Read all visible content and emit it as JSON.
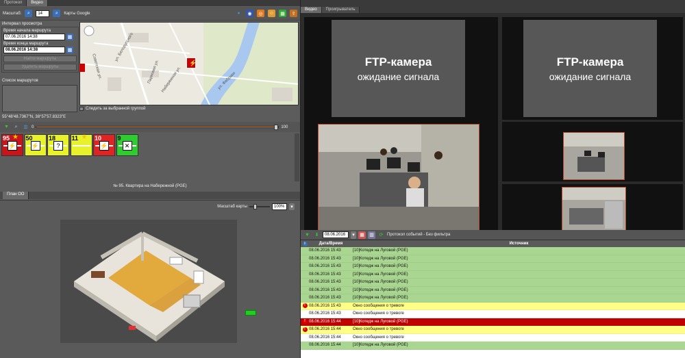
{
  "left_tabs": [
    "Протокол",
    "Видео"
  ],
  "toolbar": {
    "scale_label": "Масштаб:",
    "scale_value": "14",
    "maps_label": "Карты Google"
  },
  "interval": {
    "title": "Интервал просмотра",
    "start_label": "Время начала маршрута",
    "start_value": "07.06.2016 14:38",
    "end_label": "Время конца маршрута",
    "end_value": "08.06.2016 14:38",
    "search_btn": "Найти маршруты",
    "delete_btn": "Удалить маршруты",
    "routes_title": "Список маршрутов"
  },
  "map": {
    "follow_label": "Следить за выбранной группой",
    "coords": "55°48'48.7367\"N, 38°57'57.8323\"E",
    "streets": [
      "Советская ул.",
      "ул. Белорусского",
      "Парковая ул.",
      "Набережная ул.",
      "ул. Фабрики"
    ]
  },
  "slider": {
    "min": "0",
    "max": "100",
    "value_fraction": 1.0
  },
  "tiles": [
    {
      "num": "95",
      "color": "#c8151a",
      "icon": "run-icon",
      "glyph": "⚡",
      "star": true
    },
    {
      "num": "50",
      "color": "#e8f22a",
      "icon": "run-icon",
      "glyph": "⚡",
      "star": false
    },
    {
      "num": "18",
      "color": "#e8f22a",
      "icon": "question-icon",
      "glyph": "?",
      "star": false
    },
    {
      "num": "11",
      "color": "#e8f22a",
      "icon": "star-icon",
      "glyph": "",
      "star": true
    },
    {
      "num": "10",
      "color": "#e02424",
      "icon": "run-icon",
      "glyph": "⚡",
      "star": false
    },
    {
      "num": "9",
      "color": "#2ecc2e",
      "icon": "cross-icon",
      "glyph": "✕",
      "star": false
    }
  ],
  "plan": {
    "header": "№ 95. Квартира на Набережной (PGE)",
    "tab": "План ОО",
    "scale_label": "Масштаб карты",
    "scale_value": "100%"
  },
  "right_tabs": [
    "Видео",
    "Проигрыватель"
  ],
  "cameras": {
    "off_title": "FTP-камера",
    "off_subtitle": "ожидание сигнала"
  },
  "events_toolbar": {
    "date": "08.06.2016",
    "title": "Протокол событий - Без фильтра"
  },
  "events_table": {
    "headers": [
      "Дата/Время",
      "Источник"
    ],
    "rows": [
      {
        "time": "08.06.2016 15:43",
        "source": "[10]Котедж на Луговой (PGE)",
        "bg": "#a9d691",
        "alarm": false
      },
      {
        "time": "08.06.2016 15:43",
        "source": "[10]Котедж на Луговой (PGE)",
        "bg": "#a9d691",
        "alarm": false
      },
      {
        "time": "08.06.2016 15:43",
        "source": "[10]Котедж на Луговой (PGE)",
        "bg": "#a9d691",
        "alarm": false
      },
      {
        "time": "08.06.2016 15:43",
        "source": "[10]Котедж на Луговой (PGE)",
        "bg": "#a9d691",
        "alarm": false
      },
      {
        "time": "08.06.2016 15:43",
        "source": "[10]Котедж на Луговой (PGE)",
        "bg": "#a9d691",
        "alarm": false
      },
      {
        "time": "08.06.2016 15:43",
        "source": "[10]Котедж на Луговой (PGE)",
        "bg": "#a9d691",
        "alarm": false
      },
      {
        "time": "08.06.2016 15:43",
        "source": "[10]Котедж на Луговой (PGE)",
        "bg": "#a9d691",
        "alarm": false
      },
      {
        "time": "08.06.2016 15:43",
        "source": "Окно сообщения о тревоге",
        "bg": "#ffff88",
        "alarm": true
      },
      {
        "time": "08.06.2016 15:43",
        "source": "Окно сообщения о тревоге",
        "bg": "#ffffff",
        "alarm": false
      },
      {
        "time": "08.06.2016 15:44",
        "source": "[10]Котедж на Луговой (PGE)",
        "bg": "#c00000",
        "alarm": true
      },
      {
        "time": "08.06.2016 15:44",
        "source": "Окно сообщения о тревоге",
        "bg": "#ffff88",
        "alarm": true
      },
      {
        "time": "08.06.2016 15:44",
        "source": "Окно сообщения о тревоге",
        "bg": "#ffffff",
        "alarm": false
      },
      {
        "time": "08.06.2016 15:44",
        "source": "[10]Котедж на Луговой (PGE)",
        "bg": "#a9d691",
        "alarm": false
      }
    ]
  }
}
